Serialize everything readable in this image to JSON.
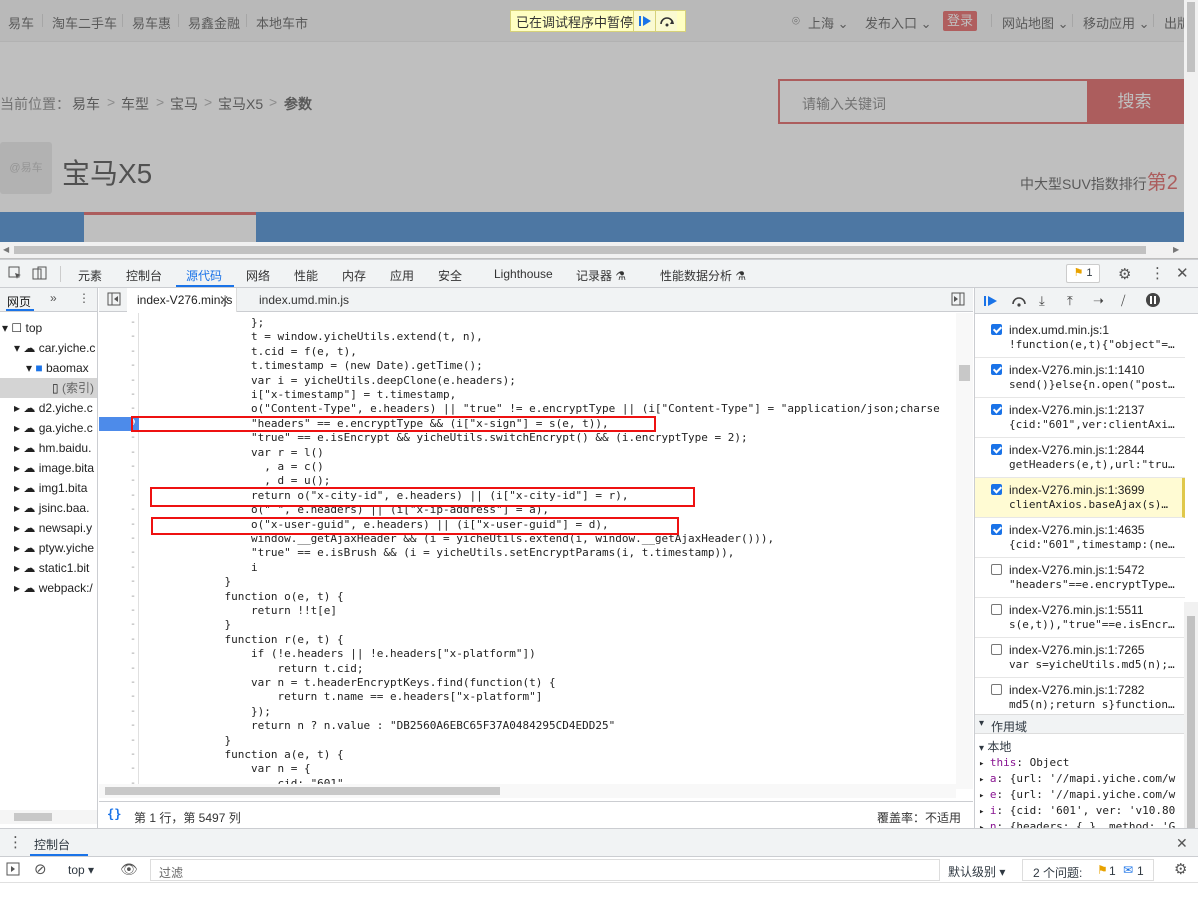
{
  "page": {
    "top_links": [
      "易车",
      "淘车二手车",
      "易车惠",
      "易鑫金融",
      "本地车市"
    ],
    "paused_text": "已在调试程序中暂停",
    "city": "上海",
    "publish": "发布入口",
    "login": "登录",
    "site_map": "网站地图",
    "mobile": "移动应用",
    "exit": "出版",
    "breadcrumb": [
      "当前位置：",
      "易车",
      ">",
      "车型",
      ">",
      "宝马",
      ">",
      "宝马X5",
      ">",
      "参数"
    ],
    "search_placeholder": "请输入关键词",
    "search_button": "搜索",
    "logo_text": "@易车",
    "car_title": "宝马X5",
    "rank_text": "中大型SUV指数排行",
    "rank_value": "第2"
  },
  "devtools": {
    "tabs": [
      "元素",
      "控制台",
      "源代码",
      "网络",
      "性能",
      "内存",
      "应用",
      "安全",
      "Lighthouse",
      "记录器",
      "性能数据分析"
    ],
    "selected_tab": "源代码",
    "issue_count": "1",
    "navigator": {
      "tab": "网页",
      "items": [
        "top",
        "car.yiche.c",
        "baomax",
        "(索引)",
        "d2.yiche.c",
        "ga.yiche.c",
        "hm.baidu.",
        "image.bita",
        "img1.bita",
        "jsinc.baa.",
        "newsapi.y",
        "ptyw.yiche",
        "static1.bit",
        "webpack:/"
      ]
    },
    "file_tabs": [
      "index-V276.min.js",
      "index.umd.min.js"
    ],
    "code_lines": [
      "                };",
      "                t = window.yicheUtils.extend(t, n),",
      "                t.cid = f(e, t),",
      "                t.timestamp = (new Date).getTime();",
      "                var i = yicheUtils.deepClone(e.headers);",
      "                i[\"x-timestamp\"] = t.timestamp,",
      "                o(\"Content-Type\", e.headers) || \"true\" != e.encryptType || (i[\"Content-Type\"] = \"application/json;charse",
      "                \"headers\" == e.encryptType && (i[\"x-sign\"] = s(e, t)),",
      "                \"true\" == e.isEncrypt && yicheUtils.switchEncrypt() && (i.encryptType = 2);",
      "                var r = l()",
      "                  , a = c()",
      "                  , d = u();",
      "                return o(\"x-city-id\", e.headers) || (i[\"x-city-id\"] = r),",
      "                o(\" \", e.headers) || (i[\"x-ip-address\"] = a),",
      "                o(\"x-user-guid\", e.headers) || (i[\"x-user-guid\"] = d),",
      "                window.__getAjaxHeader && (i = yicheUtils.extend(i, window.__getAjaxHeader())),",
      "                \"true\" == e.isBrush && (i = yicheUtils.setEncryptParams(i, t.timestamp)),",
      "                i",
      "            }",
      "            function o(e, t) {",
      "                return !!t[e]",
      "            }",
      "            function r(e, t) {",
      "                if (!e.headers || !e.headers[\"x-platform\"])",
      "                    return t.cid;",
      "                var n = t.headerEncryptKeys.find(function(t) {",
      "                    return t.name == e.headers[\"x-platform\"]",
      "                });",
      "                return n ? n.value : \"DB2560A6EBC65F37A0484295CD4EDD25\"",
      "            }",
      "            function a(e, t) {",
      "                var n = {",
      "                    cid: \"601\","
    ],
    "status_left": "第 1 行，第 5497 列",
    "status_right": "覆盖率：不适用",
    "breakpoints": [
      {
        "file": "index.umd.min.js:1",
        "code": "!function(e,t){\"object\"=…",
        "checked": true,
        "active": false
      },
      {
        "file": "index-V276.min.js:1:1410",
        "code": "send()}else{n.open(\"post…",
        "checked": true,
        "active": false
      },
      {
        "file": "index-V276.min.js:1:2137",
        "code": "{cid:\"601\",ver:clientAxi…",
        "checked": true,
        "active": false
      },
      {
        "file": "index-V276.min.js:1:2844",
        "code": "getHeaders(e,t),url:\"tru…",
        "checked": true,
        "active": false
      },
      {
        "file": "index-V276.min.js:1:3699",
        "code": "clientAxios.baseAjax(s)…",
        "checked": true,
        "active": true
      },
      {
        "file": "index-V276.min.js:1:4635",
        "code": "{cid:\"601\",timestamp:(ne…",
        "checked": true,
        "active": false
      },
      {
        "file": "index-V276.min.js:1:5472",
        "code": "\"headers\"==e.encryptType…",
        "checked": false,
        "active": false
      },
      {
        "file": "index-V276.min.js:1:5511",
        "code": "s(e,t)),\"true\"==e.isEncr…",
        "checked": false,
        "active": false
      },
      {
        "file": "index-V276.min.js:1:7265",
        "code": "var s=yicheUtils.md5(n);…",
        "checked": false,
        "active": false
      },
      {
        "file": "index-V276.min.js:1:7282",
        "code": "md5(n);return s}function…",
        "checked": false,
        "active": false
      }
    ],
    "scope_header": "作用域",
    "scope_local": "本地",
    "scope_items": [
      {
        "key": "this",
        "value": "Object"
      },
      {
        "key": "a",
        "value": "{url: '//mapi.yiche.com/w"
      },
      {
        "key": "e",
        "value": "{url: '//mapi.yiche.com/w"
      },
      {
        "key": "i",
        "value": "{cid: '601', ver: 'v10.80"
      },
      {
        "key": "n",
        "value": "{headers: {…}, method: 'G"
      }
    ],
    "drawer": {
      "tab": "控制台",
      "context": "top",
      "filter_placeholder": "过滤",
      "level": "默认级别",
      "issues_text": "2 个问题:",
      "warn_count": "1",
      "info_count": "1"
    }
  }
}
